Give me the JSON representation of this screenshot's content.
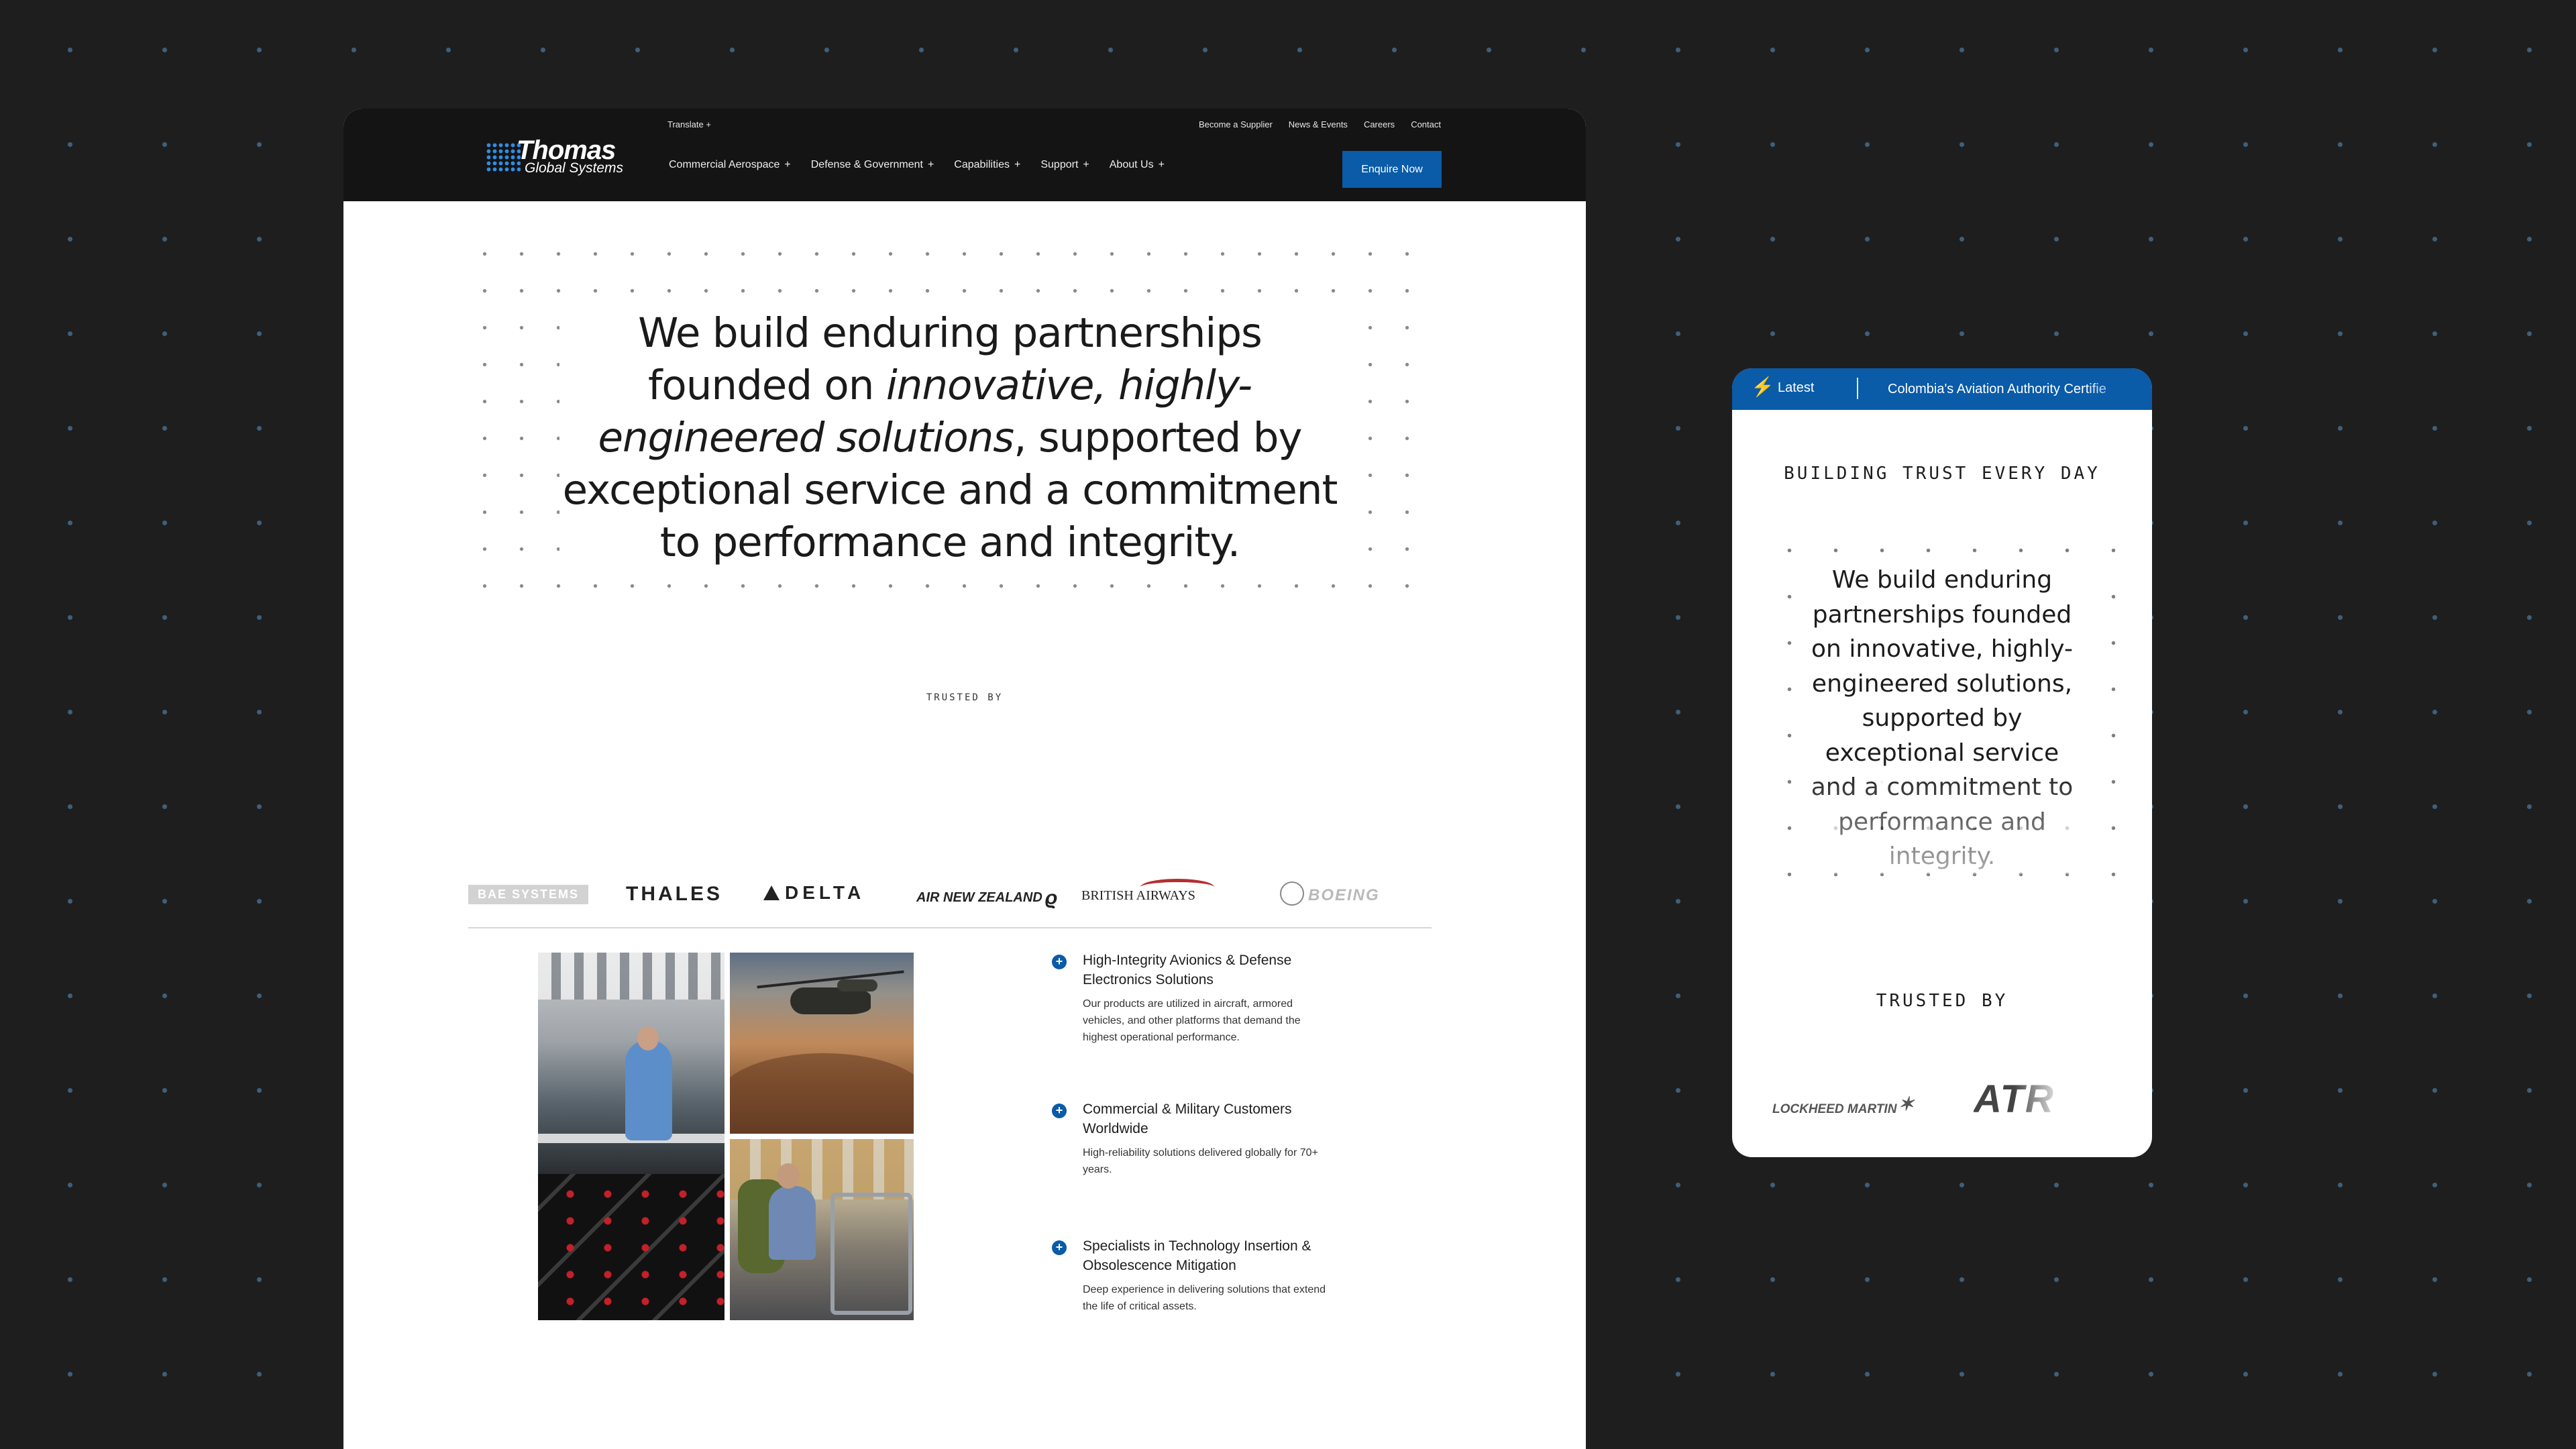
{
  "desktop": {
    "nav": {
      "logo": {
        "title": "Thomas",
        "subtitle": "Global Systems"
      },
      "translate": "Translate +",
      "utility_links": [
        "Become a Supplier",
        "News & Events",
        "Careers",
        "Contact"
      ],
      "menu": [
        {
          "label": "Commercial Aerospace",
          "suffix": "+"
        },
        {
          "label": "Defense & Government",
          "suffix": "+"
        },
        {
          "label": "Capabilities",
          "suffix": "+"
        },
        {
          "label": "Support",
          "suffix": "+"
        },
        {
          "label": "About Us",
          "suffix": "+"
        }
      ],
      "cta": "Enquire Now"
    },
    "hero": {
      "part1": "We build enduring partnerships founded on ",
      "emphasis": "innovative, highly-engineered solutions",
      "part2": ", supported by exceptional service and a commitment to performance and integrity."
    },
    "trusted_label": "TRUSTED BY",
    "logos": {
      "bae": "BAE SYSTEMS",
      "thales": "THALES",
      "delta": "DELTA",
      "anz": "AIR NEW ZEALAND",
      "ba": "BRITISH AIRWAYS",
      "boeing": "BOEING"
    },
    "features": [
      {
        "title": "High-Integrity Avionics & Defense Electronics Solutions",
        "desc": "Our products are utilized in aircraft, armored vehicles, and other platforms that demand the highest operational performance."
      },
      {
        "title": "Commercial & Military Customers Worldwide",
        "desc": "High-reliability solutions delivered globally for 70+ years."
      },
      {
        "title": "Specialists in Technology Insertion & Obsolescence Mitigation",
        "desc": "Deep experience in delivering solutions that extend the life of critical assets."
      }
    ]
  },
  "mobile": {
    "bar": {
      "icon": "lightning-icon",
      "latest": "Latest",
      "ticker": "Colombia's Aviation Authority Certifie"
    },
    "eyebrow": "BUILDING TRUST EVERY DAY",
    "hero": "We build enduring partnerships founded on innovative, highly-engineered solutions, supported by exceptional service and a commitment to performance and integrity.",
    "trusted_label": "TRUSTED BY",
    "logos": {
      "lockheed": "LOCKHEED MARTIN",
      "atr": "ATR"
    }
  },
  "colors": {
    "accent": "#0a5ba8",
    "nav_bg": "#141414",
    "page_bg": "#1e1e1f"
  }
}
